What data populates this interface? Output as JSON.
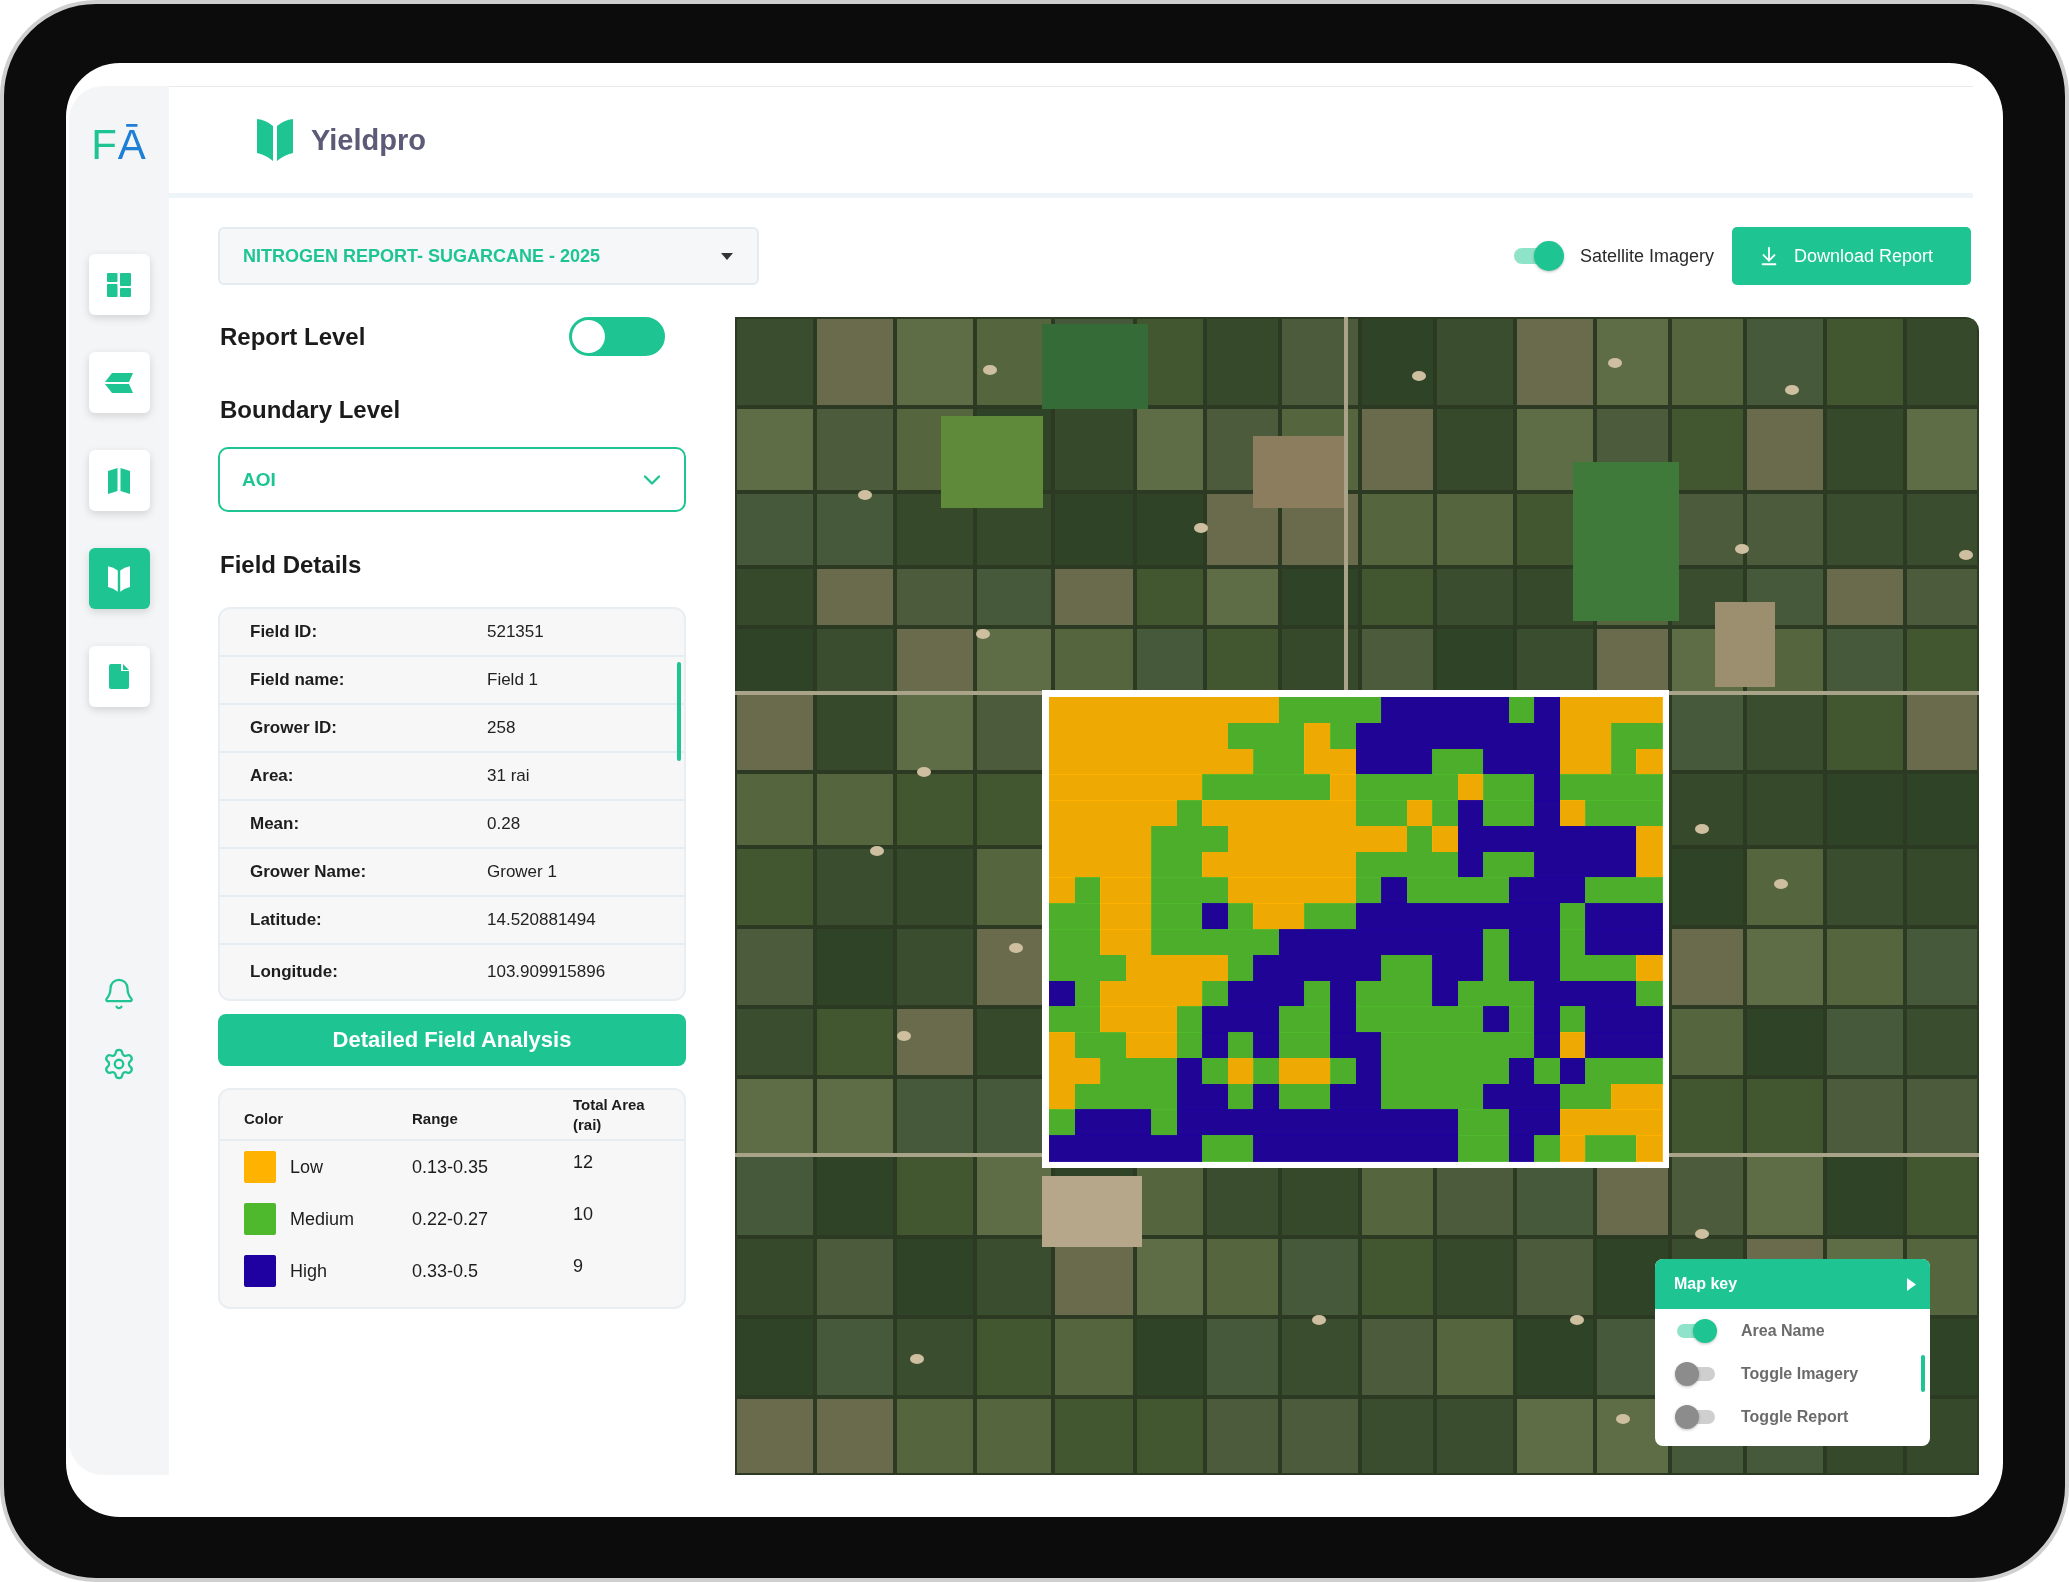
{
  "sidebar": {
    "logo": "FĀ",
    "items": [
      {
        "selected": false
      },
      {
        "selected": false
      },
      {
        "selected": false
      },
      {
        "selected": true
      },
      {
        "selected": false
      }
    ]
  },
  "header": {
    "app_name": "Yieldpro"
  },
  "toolbar": {
    "report_select": "NITROGEN REPORT- SUGARCANE - 2025",
    "satellite_imagery": {
      "label": "Satellite Imagery",
      "on": true
    },
    "download_button": "Download Report"
  },
  "panel": {
    "report_level": {
      "label": "Report Level",
      "on": false
    },
    "boundary_level": {
      "label": "Boundary Level",
      "value": "AOI"
    },
    "field_details": {
      "title": "Field Details",
      "rows": [
        {
          "label": "Field ID:",
          "value": "521351"
        },
        {
          "label": "Field name:",
          "value": "Field 1"
        },
        {
          "label": "Grower ID:",
          "value": "258"
        },
        {
          "label": "Area:",
          "value": "31 rai"
        },
        {
          "label": "Mean:",
          "value": "0.28"
        },
        {
          "label": "Grower Name:",
          "value": "Grower 1"
        },
        {
          "label": "Latitude:",
          "value": "14.520881494"
        },
        {
          "label": "Longitude:",
          "value": "103.909915896"
        }
      ]
    },
    "analysis_button": "Detailed Field Analysis",
    "legend": {
      "columns": [
        "Color",
        "Range",
        "Total Area (rai)"
      ],
      "rows": [
        {
          "name": "Low",
          "color": "#ffb300",
          "range": "0.13-0.35",
          "area": "12"
        },
        {
          "name": "Medium",
          "color": "#4fb92d",
          "range": "0.22-0.27",
          "area": "10"
        },
        {
          "name": "High",
          "color": "#1f00a0",
          "range": "0.33-0.5",
          "area": "9"
        }
      ]
    }
  },
  "map": {
    "map_key": {
      "title": "Map key",
      "items": [
        {
          "label": "Area Name",
          "on": true
        },
        {
          "label": "Toggle Imagery",
          "on": false
        },
        {
          "label": "Toggle Report",
          "on": false
        }
      ]
    }
  }
}
